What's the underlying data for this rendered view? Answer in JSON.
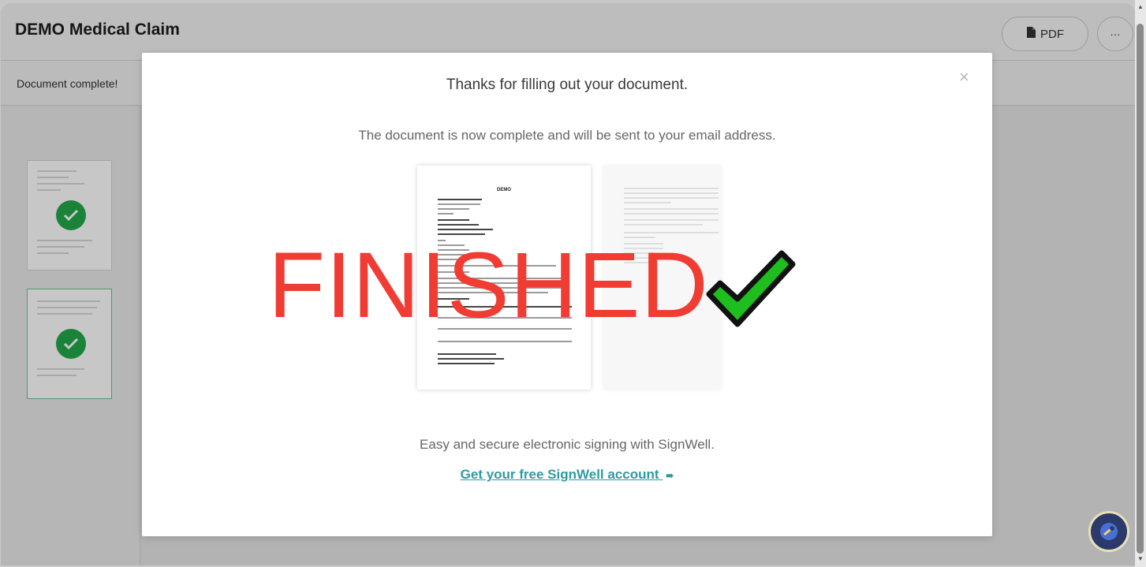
{
  "header": {
    "title": "DEMO Medical Claim",
    "pdf_label": "PDF",
    "more_label": "···"
  },
  "subbar": {
    "status": "Document complete!"
  },
  "sidebar": {
    "pages": [
      {
        "completed": true
      },
      {
        "completed": true
      }
    ]
  },
  "modal": {
    "close_label": "×",
    "title": "Thanks for filling out your document.",
    "subtitle": "The document is now complete and will be sent to your email address.",
    "overlay_text": "FINISHED",
    "footer": "Easy and secure electronic signing with SignWell.",
    "link_text": "Get your free SignWell account",
    "preview_heading": "DEMO"
  },
  "colors": {
    "accent": "#2d9a9e",
    "success": "#22a84a",
    "finished": "#f03c33"
  }
}
